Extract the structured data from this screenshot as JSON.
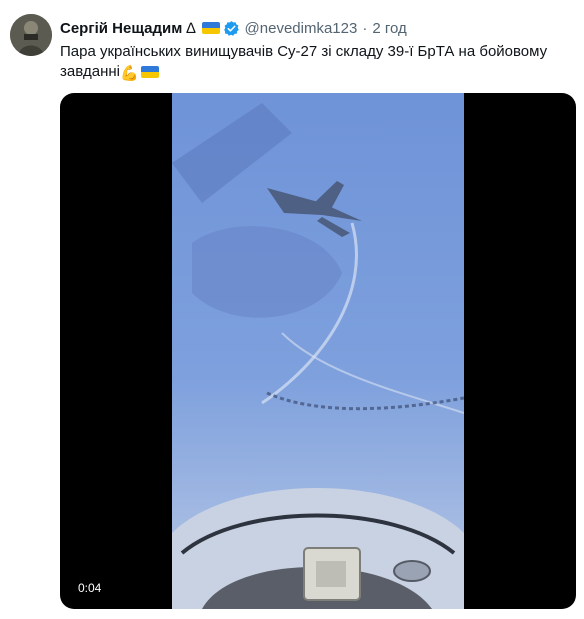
{
  "author": {
    "name": "Сергій Нещадим",
    "symbol": "∆",
    "handle": "@nevedimka123",
    "separator": "·",
    "time": "2 год",
    "flag_colors": [
      "#2f7ad9",
      "#f6c700"
    ],
    "verified_color": "#1d9bf0"
  },
  "tweet": {
    "text": "Пара українських винищувачів Су-27 зі складу 39-ї БрТА на бойовому завданні",
    "emojis": [
      "💪",
      "flag-ukraine-icon"
    ]
  },
  "media": {
    "duration": "0:04"
  }
}
